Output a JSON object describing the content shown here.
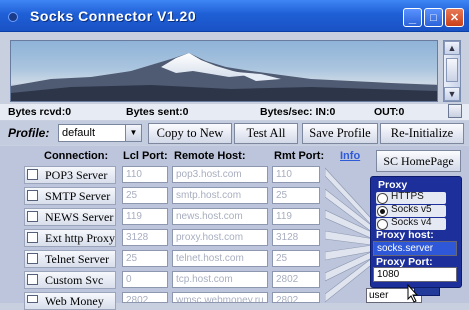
{
  "window": {
    "title": "Socks Connector V1.20",
    "controls": {
      "minimize": "_",
      "maximize": "□",
      "close": "✕"
    }
  },
  "stats": {
    "bytes_rcvd": "Bytes rcvd:0",
    "bytes_sent": "Bytes sent:0",
    "bytes_sec": "Bytes/sec: IN:0",
    "out": "OUT:0"
  },
  "profile": {
    "label": "Profile:",
    "selected": "default"
  },
  "toolbar": {
    "copy_to_new": "Copy to New",
    "test_all": "Test All",
    "save_profile": "Save Profile",
    "reinitialize": "Re-Initialize"
  },
  "table": {
    "headers": {
      "connection": "Connection:",
      "lcl_port": "Lcl Port:",
      "remote_host": "Remote Host:",
      "rmt_port": "Rmt Port:"
    },
    "info_link": "Info",
    "homepage_button": "SC HomePage",
    "rows": [
      {
        "name": "POP3 Server",
        "lcl": "110",
        "host": "pop3.host.com",
        "rmt": "110"
      },
      {
        "name": "SMTP Server",
        "lcl": "25",
        "host": "smtp.host.com",
        "rmt": "25"
      },
      {
        "name": "NEWS Server",
        "lcl": "119",
        "host": "news.host.com",
        "rmt": "119"
      },
      {
        "name": "Ext http Proxy",
        "lcl": "3128",
        "host": "proxy.host.com",
        "rmt": "3128"
      },
      {
        "name": "Telnet Server",
        "lcl": "25",
        "host": "telnet.host.com",
        "rmt": "25"
      },
      {
        "name": "Custom Svc",
        "lcl": "0",
        "host": "tcp.host.com",
        "rmt": "2802"
      },
      {
        "name": "Web Money",
        "lcl": "2802",
        "host": "wmsc.webmoney.ru",
        "rmt": "2802"
      }
    ]
  },
  "proxy": {
    "title": "Proxy",
    "options": [
      {
        "label": "HTTPS",
        "selected": false
      },
      {
        "label": "Socks v5",
        "selected": true
      },
      {
        "label": "Socks v4",
        "selected": false
      }
    ],
    "host_label": "Proxy host:",
    "host_value": "socks.server",
    "port_label": "Proxy Port:",
    "port_value": "1080"
  },
  "user_field": "user",
  "colors": {
    "titlebar": "#1f5fd6",
    "proxy_panel": "#1c2f9b",
    "link": "#2f5bd6"
  }
}
